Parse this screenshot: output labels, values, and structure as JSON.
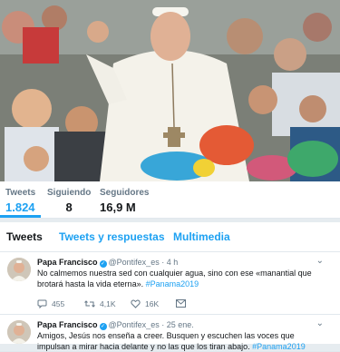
{
  "profile_stats": [
    {
      "label": "Tweets",
      "value": "1.824"
    },
    {
      "label": "Siguiendo",
      "value": "8"
    },
    {
      "label": "Seguidores",
      "value": "16,9 M"
    }
  ],
  "tabs": [
    "Tweets",
    "Tweets y respuestas",
    "Multimedia"
  ],
  "tweets": [
    {
      "name": "Papa Francisco",
      "handle": "@Pontifex_es",
      "time": "· 4 h",
      "text": "No calmemos nuestra sed con cualquier agua, sino con ese «manantial que brotará hasta la vida eterna».",
      "hashtag": "#Panama2019",
      "replies": "455",
      "retweets": "4,1K",
      "likes": "16K"
    },
    {
      "name": "Papa Francisco",
      "handle": "@Pontifex_es",
      "time": "· 25 ene.",
      "text": "Amigos, Jesús nos enseña a creer. Busquen y escuchen las voces que impulsan a mirar hacia delante y no las que los tiran abajo.",
      "hashtag": "#Panama2019"
    }
  ],
  "colors": {
    "accent": "#1da1f2",
    "text": "#14171a",
    "muted": "#657786",
    "background": "#e6ecf0"
  },
  "icons": [
    "verified-badge-icon",
    "chevron-down-icon",
    "reply-icon",
    "retweet-icon",
    "like-icon",
    "message-icon"
  ]
}
